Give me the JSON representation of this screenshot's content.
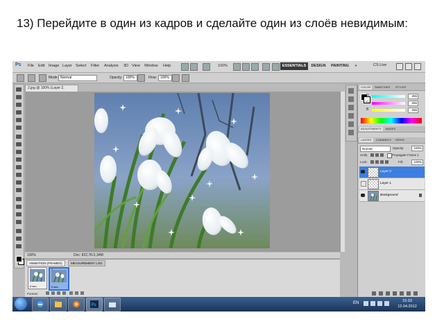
{
  "heading": "13) Перейдите в один из кадров и сделайте один из слоёв невидимым:",
  "app": {
    "logo": "Ps",
    "menu": [
      "File",
      "Edit",
      "Image",
      "Layer",
      "Select",
      "Filter",
      "Analysis",
      "3D",
      "View",
      "Window",
      "Help"
    ],
    "zoom_label": "100%",
    "workspaces": [
      "ESSENTIALS",
      "DESIGN",
      "PAINTING",
      "»"
    ],
    "cs_live": "CS Live"
  },
  "options_bar": {
    "mode_label": "Mode:",
    "mode_value": "Normal",
    "opacity_label": "Opacity:",
    "opacity_value": "100%",
    "flow_label": "Flow:",
    "flow_value": "100%"
  },
  "document": {
    "tab_title": "2.jpg @ 100% (Layer 2, RGB/8#)",
    "status_zoom": "100%",
    "status_doc": "Doc: 822,7K/1,34M"
  },
  "animation": {
    "tabs": [
      "ANIMATION (FRAMES)",
      "MEASUREMENT LOG"
    ],
    "frames": [
      {
        "num": "1",
        "delay": "0 sec.",
        "selected": false
      },
      {
        "num": "2",
        "delay": "0 sec.",
        "selected": true
      }
    ],
    "loop": "Forever"
  },
  "color_panel": {
    "tabs": [
      "COLOR",
      "SWATCHES",
      "STYLES"
    ],
    "channels": [
      {
        "label": "R",
        "value": "255",
        "color": "#e03030"
      },
      {
        "label": "G",
        "value": "255",
        "color": "#30b030"
      },
      {
        "label": "B",
        "value": "255",
        "color": "#3050e0"
      }
    ]
  },
  "adjust_panel": {
    "tabs": [
      "ADJUSTMENTS",
      "MASKS"
    ]
  },
  "layers_panel": {
    "tabs": [
      "LAYERS",
      "CHANNELS",
      "PATHS"
    ],
    "blend_mode": "Normal",
    "opacity_label": "Opacity:",
    "opacity_value": "100%",
    "unify_label": "Unify:",
    "propagate_label": "Propagate Frame 1",
    "lock_label": "Lock:",
    "fill_label": "Fill:",
    "fill_value": "100%",
    "layers": [
      {
        "name": "Layer 2",
        "selected": true,
        "visible": true
      },
      {
        "name": "Layer 1",
        "selected": false,
        "visible": false
      },
      {
        "name": "Background",
        "selected": false,
        "visible": true
      }
    ]
  },
  "taskbar": {
    "language": "EN",
    "time": "15:33",
    "date": "12.04.2012",
    "apps": [
      "ie-icon",
      "explorer-icon",
      "media-player-icon",
      "photoshop-icon",
      "window-icon"
    ]
  }
}
